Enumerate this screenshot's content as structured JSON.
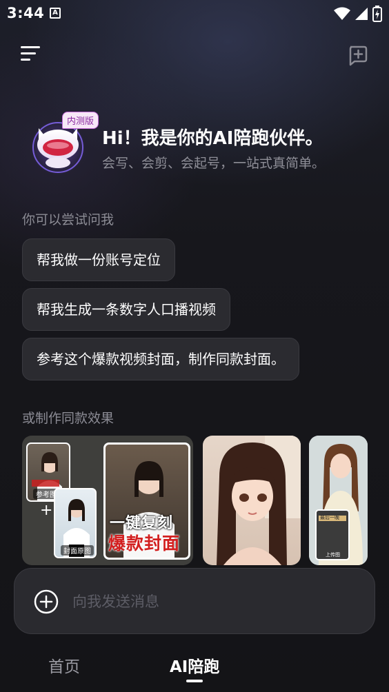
{
  "status_bar": {
    "time": "3:44",
    "app_icon_letter": "A"
  },
  "top_bar": {
    "menu_icon": "menu-icon",
    "new_chat_icon": "new-chat-icon"
  },
  "hero": {
    "badge": "内测版",
    "title": "Hi！我是你的AI陪跑伙伴。",
    "subtitle": "会写、会剪、会起号，一站式真简单。"
  },
  "suggestions": {
    "label": "你可以尝试问我",
    "items": [
      {
        "text": "帮我做一份账号定位"
      },
      {
        "text": "帮我生成一条数字人口播视频"
      },
      {
        "text": "参考这个爆款视频封面，制作同款封面。"
      }
    ]
  },
  "templates": {
    "label": "或制作同款效果",
    "card1": {
      "ref_label": "参考图",
      "orig_label": "封面原图",
      "big_line1": "一键复刻",
      "big_line2": "爆款封面"
    },
    "card3": {
      "sign_text": "最后一晚",
      "small_label": "上传图"
    }
  },
  "input": {
    "placeholder": "向我发送消息"
  },
  "tabs": [
    {
      "label": "首页",
      "active": false
    },
    {
      "label": "AI陪跑",
      "active": true
    }
  ],
  "colors": {
    "accent_badge": "#c56ad8",
    "chip_bg": "#2b2b30",
    "cover_red": "#d21f1f"
  }
}
